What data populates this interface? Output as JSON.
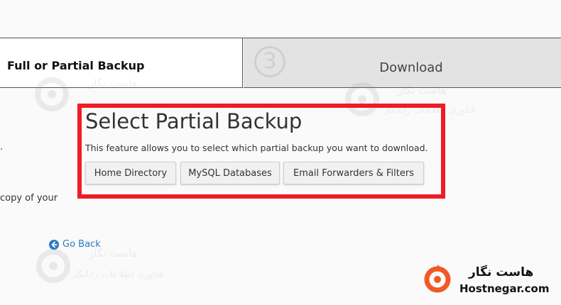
{
  "steps": {
    "active_label": "Full or Partial Backup",
    "next_number": "3",
    "next_label": "Download"
  },
  "left_fragments": {
    "dot": ".",
    "copy": "copy of your"
  },
  "panel": {
    "title": "Select Partial Backup",
    "description": "This feature allows you to select which partial backup you want to download.",
    "buttons": [
      "Home Directory",
      "MySQL Databases",
      "Email Forwarders & Filters"
    ]
  },
  "go_back": "Go Back",
  "watermark": {
    "name": "هاست نگار",
    "tagline": "فناوری اطلاعات رایانگار"
  },
  "brand": {
    "name_fa": "هاست نگار",
    "name_en": "Hostnegar.com"
  },
  "colors": {
    "highlight": "#ee1d25",
    "link": "#2a7bc0",
    "logo_orange": "#f15a22"
  },
  "icons": {
    "go_back": "circle-arrow-left-icon",
    "brand": "hostnegar-logo-icon"
  }
}
